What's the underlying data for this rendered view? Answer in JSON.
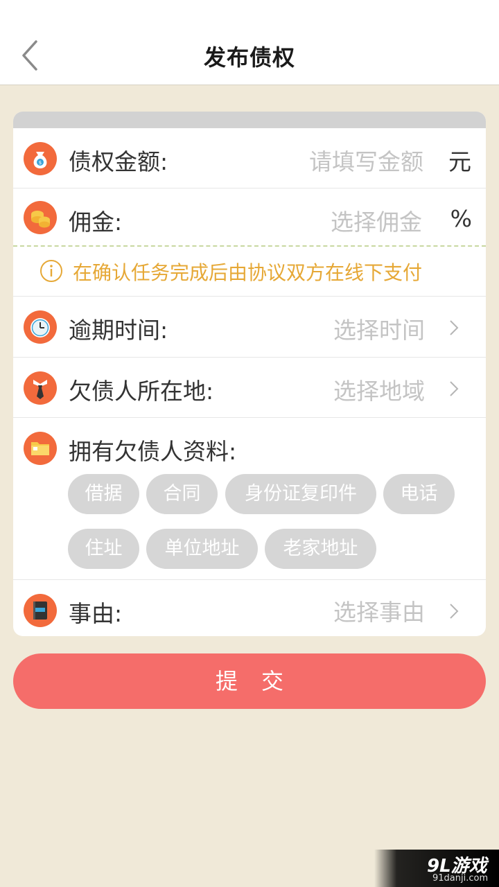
{
  "header": {
    "title": "发布债权"
  },
  "amount": {
    "label": "债权金额:",
    "placeholder": "请填写金额",
    "unit": "元"
  },
  "commission": {
    "label": "佣金:",
    "placeholder": "选择佣金",
    "unit": "%"
  },
  "notice": {
    "text": "在确认任务完成后由协议双方在线下支付"
  },
  "overdue": {
    "label": "逾期时间:",
    "placeholder": "选择时间"
  },
  "location": {
    "label": "欠债人所在地:",
    "placeholder": "选择地域"
  },
  "materials": {
    "label": "拥有欠债人资料:",
    "tags": [
      "借据",
      "合同",
      "身份证复印件",
      "电话",
      "住址",
      "单位地址",
      "老家地址"
    ]
  },
  "reason": {
    "label": "事由:",
    "placeholder": "选择事由"
  },
  "submit": {
    "label": "提交"
  },
  "watermark": {
    "brand": "9L游戏",
    "site": "91danji.com"
  },
  "colors": {
    "accent": "#f26a3c",
    "submit": "#f56d6a",
    "notice": "#e6a836",
    "background": "#f0e9d8"
  }
}
